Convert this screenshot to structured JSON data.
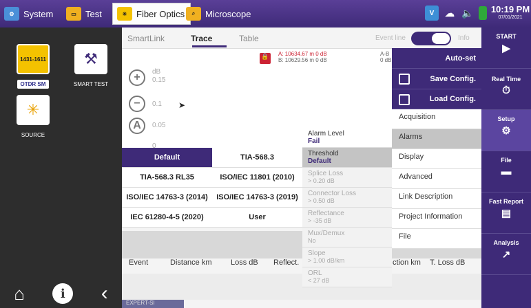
{
  "topbar": {
    "tabs": [
      {
        "label": "System"
      },
      {
        "label": "Test"
      },
      {
        "label": "Fiber Optics"
      },
      {
        "label": "Microscope"
      }
    ],
    "clock_time": "10:19 PM",
    "clock_date": "07/01/2021"
  },
  "leftbar": {
    "modules": [
      {
        "label": "OTDR SM",
        "badge": "1431-1611"
      },
      {
        "label": "SMART TEST"
      },
      {
        "label": "SOURCE"
      }
    ]
  },
  "subtabs": [
    "SmartLink",
    "Trace",
    "Table"
  ],
  "event_line": {
    "label": "Event line",
    "info": "Info"
  },
  "markers": {
    "a": "A: 10634.67 m 0 dB",
    "b": "B: 10629.56 m 0 dB",
    "ab": "A-B",
    "ab_val": "0 dB"
  },
  "trace": {
    "yunit": "dB",
    "yticks": [
      "0.15",
      "0.1",
      "0.05",
      "0"
    ]
  },
  "rightbar": [
    "START",
    "Real Time",
    "Setup",
    "File",
    "Fast Report",
    "Analysis"
  ],
  "setup_menu": {
    "autoset": "Auto-set",
    "save": "Save Config.",
    "load": "Load Config.",
    "items": [
      "Acquisition",
      "Alarms",
      "Display",
      "Advanced",
      "Link Description",
      "Project Information",
      "File"
    ]
  },
  "alarms": [
    {
      "label": "Alarm Level",
      "value": "Fail"
    },
    {
      "label": "Threshold",
      "value": "Default"
    },
    {
      "label": "Splice Loss",
      "value": "> 0.20 dB"
    },
    {
      "label": "Connector Loss",
      "value": "> 0.50 dB"
    },
    {
      "label": "Reflectance",
      "value": "> -35 dB"
    },
    {
      "label": "Mux/Demux",
      "value": "No"
    },
    {
      "label": "Slope",
      "value": "> 1.00 dB/km"
    },
    {
      "label": "ORL",
      "value": "< 27 dB"
    }
  ],
  "standards": [
    "Default",
    "TIA-568.3",
    "TIA-568.3 RL35",
    "ISO/IEC 11801 (2010)",
    "ISO/IEC 14763-3 (2014)",
    "ISO/IEC 14763-3 (2019)",
    "IEC 61280-4-5 (2020)",
    "User"
  ],
  "table": {
    "headers": [
      "Event",
      "Distance km",
      "Loss dB",
      "Reflect.",
      "ction km",
      "T. Loss dB"
    ]
  },
  "expert": "EXPERT-SI"
}
